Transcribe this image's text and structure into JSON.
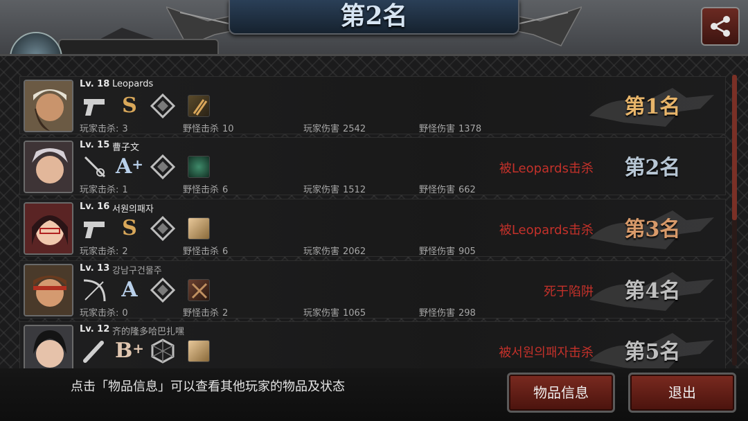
{
  "header": {
    "title": "第2名"
  },
  "share": {
    "icon": "share-icon"
  },
  "players": [
    {
      "level": "Lv. 18",
      "name": "Leopards",
      "weapon_icon": "pistol-icon",
      "grade": "S",
      "grade_plus": "",
      "armor_icon": "diamond-emblem-icon",
      "item_icon": "item-bullets-icon",
      "player_kills_label": "玩家击杀:",
      "player_kills": "3",
      "monster_kills_label": "野怪击杀",
      "monster_kills": "10",
      "player_damage_label": "玩家伤害",
      "player_damage": "2542",
      "monster_damage_label": "野怪伤害",
      "monster_damage": "1378",
      "status": "",
      "rank": "第1名"
    },
    {
      "level": "Lv. 15",
      "name": "曹子文",
      "weapon_icon": "rapier-icon",
      "grade": "A",
      "grade_plus": "+",
      "armor_icon": "diamond-emblem-icon",
      "item_icon": "item-green-icon",
      "player_kills_label": "玩家击杀:",
      "player_kills": "1",
      "monster_kills_label": "野怪击杀",
      "monster_kills": "6",
      "player_damage_label": "玩家伤害",
      "player_damage": "1512",
      "monster_damage_label": "野怪伤害",
      "monster_damage": "662",
      "status": "被Leopards击杀",
      "rank": "第2名"
    },
    {
      "level": "Lv. 16",
      "name": "서원의패자",
      "weapon_icon": "pistol-icon",
      "grade": "S",
      "grade_plus": "",
      "armor_icon": "diamond-emblem-icon",
      "item_icon": "item-bandage-icon",
      "player_kills_label": "玩家击杀:",
      "player_kills": "2",
      "monster_kills_label": "野怪击杀",
      "monster_kills": "6",
      "player_damage_label": "玩家伤害",
      "player_damage": "2062",
      "monster_damage_label": "野怪伤害",
      "monster_damage": "905",
      "status": "被Leopards击杀",
      "rank": "第3名"
    },
    {
      "level": "Lv. 13",
      "name": "강남구건물주",
      "weapon_icon": "crossbow-icon",
      "grade": "A",
      "grade_plus": "",
      "armor_icon": "diamond-emblem-icon",
      "item_icon": "item-crossed-icon",
      "player_kills_label": "玩家击杀:",
      "player_kills": "0",
      "monster_kills_label": "野怪击杀",
      "monster_kills": "2",
      "player_damage_label": "玩家伤害",
      "player_damage": "1065",
      "monster_damage_label": "野怪伤害",
      "monster_damage": "298",
      "status": "死于陷阱",
      "rank": "第4名"
    },
    {
      "level": "Lv. 12",
      "name": "齐的隆多哈巴扎嘿",
      "weapon_icon": "bat-icon",
      "grade": "B",
      "grade_plus": "+",
      "armor_icon": "hexagon-emblem-icon",
      "item_icon": "item-bandage-icon",
      "status": "被서원의패자击杀",
      "rank": "第5名"
    }
  ],
  "footer": {
    "hint": "点击「物品信息」可以查看其他玩家的物品及状态",
    "items_button": "物品信息",
    "exit_button": "退出"
  },
  "colors": {
    "accent_red": "#c4312a",
    "gold": "#e8b56a",
    "button_red": "#7a2a20"
  }
}
